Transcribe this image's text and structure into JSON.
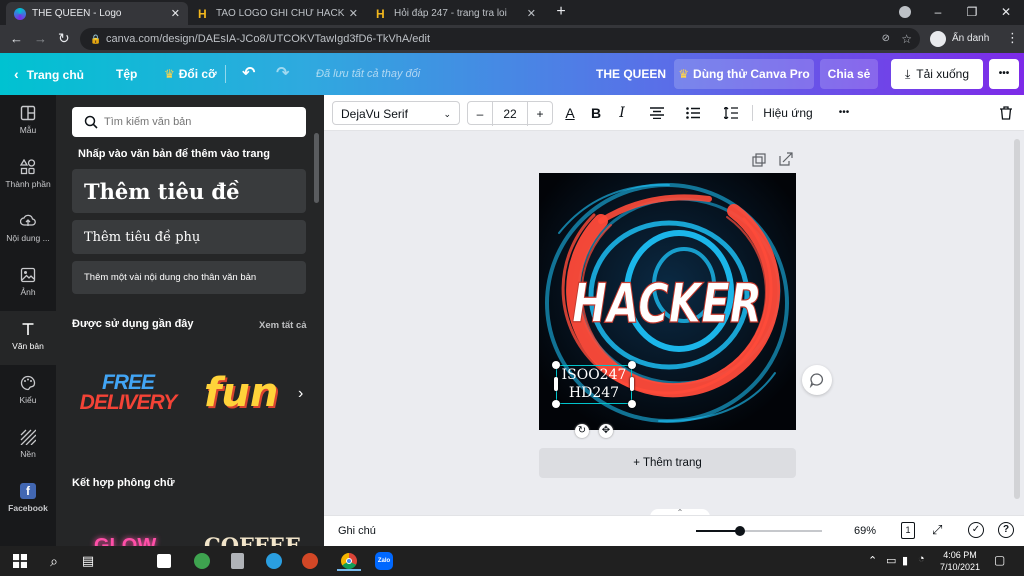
{
  "browser": {
    "tabs": [
      {
        "title": "THE QUEEN - Logo",
        "active": true
      },
      {
        "title": "TAO LOGO GHI CHỮ HACKER KC",
        "active": false
      },
      {
        "title": "Hỏi đáp 247 - trang tra loi",
        "active": false
      }
    ],
    "new_tab": "+",
    "url": "canva.com/design/DAEsIA-JCo8/UTCOKVTawIgd3fD6-TkVhA/edit",
    "profile_label": "Ẩn danh"
  },
  "header": {
    "home": "Trang chủ",
    "file": "Tệp",
    "resize": "Đổi cỡ",
    "saved": "Đã lưu tất cả thay đổi",
    "title": "THE QUEEN",
    "try_pro": "Dùng thử Canva Pro",
    "share": "Chia sẻ",
    "download": "Tải xuống",
    "more": "•••"
  },
  "rail": [
    {
      "label": "Mẫu",
      "icon": "layout-icon"
    },
    {
      "label": "Thành phần",
      "icon": "elements-icon"
    },
    {
      "label": "Nội dung ...",
      "icon": "upload-icon"
    },
    {
      "label": "Ảnh",
      "icon": "photo-icon"
    },
    {
      "label": "Văn bản",
      "icon": "text-icon",
      "selected": true
    },
    {
      "label": "Kiểu",
      "icon": "palette-icon"
    },
    {
      "label": "Nền",
      "icon": "background-icon"
    },
    {
      "label": "Facebook",
      "icon": "facebook-icon"
    }
  ],
  "panel": {
    "search_placeholder": "Tìm kiếm văn bản",
    "click_hint": "Nhấp vào văn bản để thêm vào trang",
    "add_heading": "Thêm tiêu đề",
    "add_subheading": "Thêm tiêu đề phụ",
    "add_body": "Thêm một vài nội dung cho thân văn bản",
    "recent_title": "Được sử dụng gần đây",
    "see_all": "Xem tất cả",
    "recent_items": [
      {
        "lines": [
          "FREE",
          "DELIVERY"
        ]
      },
      {
        "lines": [
          "fun"
        ]
      }
    ],
    "font_combos_title": "Kết hợp phông chữ",
    "combo_items": [
      "GLOW",
      "COFFEE"
    ]
  },
  "toolbar": {
    "font": "DejaVu Serif",
    "minus": "–",
    "size": "22",
    "plus": "+",
    "text_color_glyph": "A",
    "bold": "B",
    "italic": "I",
    "effects": "Hiệu ứng",
    "more": "•••"
  },
  "canvas": {
    "headline": "HACKER",
    "selected_text_line1": "ISOO247",
    "selected_text_line2": "HD247",
    "add_page": "+ Thêm trang"
  },
  "bottom": {
    "notes": "Ghi chú",
    "zoom_percent": 69,
    "zoom_label": "69%",
    "page_count": "1",
    "help": "?"
  },
  "taskbar": {
    "time": "4:06 PM",
    "date": "7/10/2021",
    "zalo": "Zalo"
  },
  "colors": {
    "accent_gradient_start": "#00c2d1",
    "accent_gradient_end": "#7d2ae8",
    "panel_bg": "#252627",
    "rail_bg": "#18191b",
    "ring_red": "#ff4b3a",
    "swirl_blue": "#1ec8ff"
  }
}
